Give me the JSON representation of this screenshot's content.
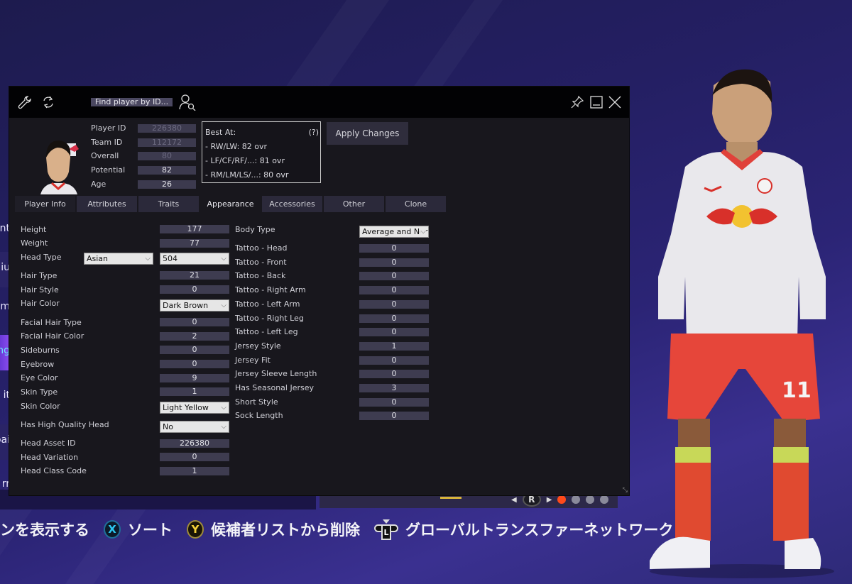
{
  "editor": {
    "find_player_label": "Find player by ID...",
    "player_info": [
      {
        "label": "Player ID",
        "value": "226380",
        "disabled": true
      },
      {
        "label": "Team ID",
        "value": "112172",
        "disabled": true
      },
      {
        "label": "Overall",
        "value": "80",
        "disabled": true
      },
      {
        "label": "Potential",
        "value": "82",
        "disabled": false
      },
      {
        "label": "Age",
        "value": "26",
        "disabled": false
      }
    ],
    "best_at": {
      "title": "Best At:",
      "help": "(?)",
      "lines": [
        "- RW/LW: 82 ovr",
        "- LF/CF/RF/...: 81 ovr",
        "- RM/LM/LS/...: 80 ovr"
      ]
    },
    "apply_label": "Apply Changes",
    "tabs": [
      {
        "label": "Player Info"
      },
      {
        "label": "Attributes"
      },
      {
        "label": "Traits"
      },
      {
        "label": "Appearance",
        "active": true
      },
      {
        "label": "Accessories"
      },
      {
        "label": "Other"
      },
      {
        "label": "Clone"
      }
    ],
    "appearance_left": {
      "height": {
        "label": "Height",
        "value": "177"
      },
      "weight": {
        "label": "Weight",
        "value": "77"
      },
      "head_type": {
        "label": "Head Type",
        "group": "Asian",
        "value": "504"
      },
      "hair_type": {
        "label": "Hair Type",
        "value": "21"
      },
      "hair_style": {
        "label": "Hair Style",
        "value": "0"
      },
      "hair_color": {
        "label": "Hair Color",
        "value": "Dark Brown"
      },
      "facial_hair_type": {
        "label": "Facial Hair Type",
        "value": "0"
      },
      "facial_hair_color": {
        "label": "Facial Hair Color",
        "value": "2"
      },
      "sideburns": {
        "label": "Sideburns",
        "value": "0"
      },
      "eyebrow": {
        "label": "Eyebrow",
        "value": "0"
      },
      "eye_color": {
        "label": "Eye Color",
        "value": "9"
      },
      "skin_type": {
        "label": "Skin Type",
        "value": "1"
      },
      "skin_color": {
        "label": "Skin Color",
        "value": "Light Yellow"
      },
      "hq_head": {
        "label": "Has High Quality Head",
        "value": "No"
      },
      "head_asset_id": {
        "label": "Head Asset ID",
        "value": "226380"
      },
      "head_variation": {
        "label": "Head Variation",
        "value": "0"
      },
      "head_class_code": {
        "label": "Head Class Code",
        "value": "1"
      }
    },
    "appearance_right": {
      "body_type": {
        "label": "Body Type",
        "value": "Average and Normal"
      },
      "fields": [
        {
          "label": "Tattoo - Head",
          "value": "0"
        },
        {
          "label": "Tattoo - Front",
          "value": "0"
        },
        {
          "label": "Tattoo - Back",
          "value": "0"
        },
        {
          "label": "Tattoo - Right Arm",
          "value": "0"
        },
        {
          "label": "Tattoo - Left Arm",
          "value": "0"
        },
        {
          "label": "Tattoo - Right Leg",
          "value": "0"
        },
        {
          "label": "Tattoo - Left Leg",
          "value": "0"
        },
        {
          "label": "Jersey Style",
          "value": "1"
        },
        {
          "label": "Jersey Fit",
          "value": "0"
        },
        {
          "label": "Jersey Sleeve Length",
          "value": "0"
        },
        {
          "label": "Has Seasonal Jersey",
          "value": "3"
        },
        {
          "label": "Short Style",
          "value": "0"
        },
        {
          "label": "Sock Length",
          "value": "0"
        }
      ]
    }
  },
  "game": {
    "left_menu_fragments": [
      "nt",
      "iu",
      "m",
      "ng",
      "it",
      "oai",
      "rr"
    ],
    "pager": {
      "button": "R",
      "pages": 4,
      "active_page": 1
    },
    "hints": [
      {
        "text": "ンを表示する"
      },
      {
        "button": "X",
        "text": "ソート"
      },
      {
        "button": "Y",
        "text": "候補者リストから削除"
      },
      {
        "button": "L",
        "text": "グローバルトランスファーネットワーク"
      }
    ],
    "colors": {
      "accent": "#ff4a1a",
      "x_button": "#2cc7f0",
      "y_button": "#f5d23a"
    },
    "player_number": "11"
  }
}
